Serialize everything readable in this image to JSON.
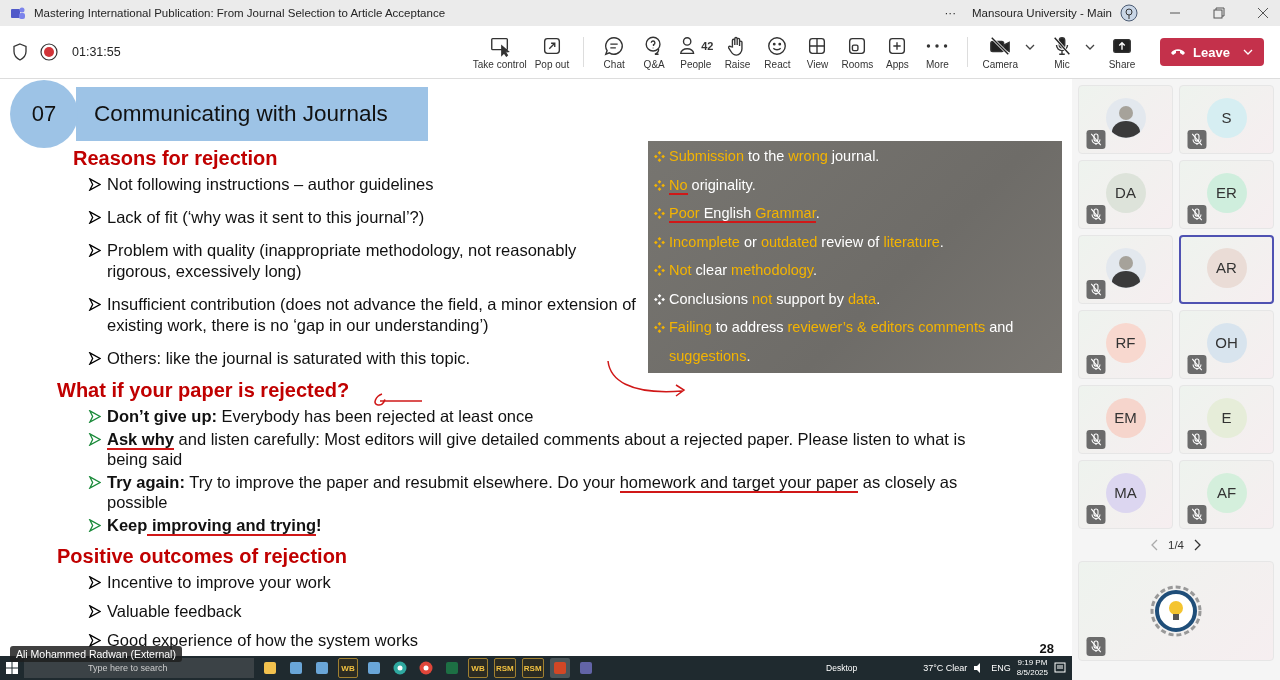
{
  "window": {
    "title": "Mastering International Publication: From Journal Selection to Article Acceptance",
    "account": "Mansoura University - Main",
    "more": "···"
  },
  "meeting": {
    "timer": "01:31:55",
    "recording": true
  },
  "toolbar": [
    {
      "kind": "take-control",
      "label": "Take control"
    },
    {
      "kind": "pop-out",
      "label": "Pop out"
    },
    {
      "kind": "divider"
    },
    {
      "kind": "chat",
      "label": "Chat"
    },
    {
      "kind": "qa",
      "label": "Q&A"
    },
    {
      "kind": "people",
      "label": "People",
      "count": "42"
    },
    {
      "kind": "raise",
      "label": "Raise"
    },
    {
      "kind": "react",
      "label": "React"
    },
    {
      "kind": "view",
      "label": "View"
    },
    {
      "kind": "rooms",
      "label": "Rooms"
    },
    {
      "kind": "apps",
      "label": "Apps"
    },
    {
      "kind": "more",
      "label": "More"
    },
    {
      "kind": "divider"
    },
    {
      "kind": "camera",
      "label": "Camera",
      "dropdown": true
    },
    {
      "kind": "mic",
      "label": "Mic",
      "dropdown": true
    },
    {
      "kind": "share",
      "label": "Share"
    }
  ],
  "leave_button": {
    "label": "Leave"
  },
  "slide": {
    "number": "07",
    "title": "Communicating with Journals",
    "page": "28",
    "sections": [
      {
        "title": "Reasons for rejection",
        "color": "#000000",
        "bullets": [
          [
            {
              "text": "Not following instructions – author guidelines",
              "ink": false
            }
          ],
          [
            {
              "text": "Lack of fit (‘why was it sent to this journal’?)",
              "ink": false
            }
          ],
          [
            {
              "text": "Problem with quality (inappropriate methodology, not reasonably rigorous, excessively long)",
              "ink": false
            }
          ],
          [
            {
              "text": "Insufficient contribution (does not advance the field, a minor extension of existing work, there is no ‘gap in our understanding’)",
              "ink": false
            }
          ],
          [
            {
              "text": "Others: like the journal is saturated with this topic.",
              "ink": false
            }
          ]
        ]
      },
      {
        "title": "What if your paper is rejected?",
        "color": "#1a8a3a",
        "bullets": [
          [
            {
              "text": "**Don’t give up:** Everybody has been rejected at least once",
              "ink": false
            }
          ],
          [
            {
              "text": "**Ask why**",
              "ink": true
            },
            {
              "text": " and listen carefully: Most editors will give detailed comments about a rejected paper. Please listen to what is being said",
              "ink": false
            }
          ],
          [
            {
              "text": "**Try again:** Try to improve the paper and resubmit elsewhere. Do your ",
              "ink": false
            },
            {
              "text": "homework and target your paper",
              "ink": true
            },
            {
              "text": " as closely as possible",
              "ink": false
            }
          ],
          [
            {
              "text": "**Keep**",
              "ink": false
            },
            {
              "text": " **improving and trying**",
              "ink": true
            },
            {
              "text": "**!**",
              "ink": false
            }
          ]
        ]
      },
      {
        "title": "Positive outcomes of rejection",
        "color": "#000000",
        "bullets": [
          [
            {
              "text": "Incentive to improve your work",
              "ink": false
            }
          ],
          [
            {
              "text": "Valuable feedback",
              "ink": false
            }
          ],
          [
            {
              "text": "Good experience of how the system works",
              "ink": false
            }
          ]
        ]
      }
    ],
    "callout": [
      [
        {
          "text": "Submission",
          "highlight": true,
          "ink": false
        },
        {
          "text": " to the ",
          "highlight": false,
          "ink": false
        },
        {
          "text": "wrong",
          "highlight": true,
          "ink": false
        },
        {
          "text": " journal.",
          "highlight": false,
          "ink": false
        }
      ],
      [
        {
          "text": "No",
          "highlight": true,
          "ink": true
        },
        {
          "text": " originality.",
          "highlight": false,
          "ink": false
        }
      ],
      [
        {
          "text": "Poor ",
          "highlight": true,
          "ink": true
        },
        {
          "text": "English",
          "highlight": false,
          "ink": true
        },
        {
          "text": " Grammar",
          "highlight": true,
          "ink": true
        },
        {
          "text": ".",
          "highlight": false,
          "ink": false
        }
      ],
      [
        {
          "text": "Incomplete",
          "highlight": true,
          "ink": false
        },
        {
          "text": " or ",
          "highlight": false,
          "ink": false
        },
        {
          "text": "outdated",
          "highlight": true,
          "ink": false
        },
        {
          "text": " review of ",
          "highlight": false,
          "ink": false
        },
        {
          "text": "literature",
          "highlight": true,
          "ink": false
        },
        {
          "text": ".",
          "highlight": false,
          "ink": false
        }
      ],
      [
        {
          "text": "Not",
          "highlight": true,
          "ink": false
        },
        {
          "text": " clear ",
          "highlight": false,
          "ink": false
        },
        {
          "text": "methodology",
          "highlight": true,
          "ink": false
        },
        {
          "text": ".",
          "highlight": false,
          "ink": false
        }
      ],
      [
        {
          "text": "Conclusions ",
          "highlight": false,
          "ink": false
        },
        {
          "text": "not",
          "highlight": true,
          "ink": false
        },
        {
          "text": " support by ",
          "highlight": false,
          "ink": false
        },
        {
          "text": "data",
          "highlight": true,
          "ink": false
        },
        {
          "text": ".",
          "highlight": false,
          "ink": false
        }
      ],
      [
        {
          "text": "Failing",
          "highlight": true,
          "ink": false
        },
        {
          "text": " to address ",
          "highlight": false,
          "ink": false
        },
        {
          "text": "reviewer’s & editors comments",
          "highlight": true,
          "ink": false
        },
        {
          "text": " and ",
          "highlight": false,
          "ink": false
        },
        {
          "text": "suggestions",
          "highlight": true,
          "ink": false
        },
        {
          "text": ".",
          "highlight": false,
          "ink": false
        }
      ]
    ]
  },
  "presenter_label": "Ali Mohammed Radwan (External)",
  "taskbar": {
    "search_placeholder": "Type here to search",
    "apps": [
      {
        "kind": "folder",
        "selected": false
      },
      {
        "kind": "app",
        "selected": false
      },
      {
        "kind": "app",
        "selected": false
      },
      {
        "kind": "badge",
        "label": "WB",
        "selected": false
      },
      {
        "kind": "app",
        "selected": false
      },
      {
        "kind": "edge",
        "selected": false
      },
      {
        "kind": "chrome",
        "selected": false
      },
      {
        "kind": "excel",
        "selected": false
      },
      {
        "kind": "badge",
        "label": "WB",
        "selected": false
      },
      {
        "kind": "badge",
        "label": "RSM",
        "selected": false
      },
      {
        "kind": "badge",
        "label": "RSM",
        "selected": false
      },
      {
        "kind": "powerpoint",
        "selected": true
      },
      {
        "kind": "teams",
        "selected": false
      }
    ],
    "desktop": "Desktop",
    "weather": "37°C  Clear",
    "language": "ENG",
    "time": "9:19 PM",
    "date": "8/5/2025"
  },
  "participants": [
    {
      "kind": "photo",
      "muted": true,
      "selected": false
    },
    {
      "kind": "initials",
      "initials": "S",
      "color": "#d6eef2",
      "muted": true,
      "selected": false
    },
    {
      "kind": "initials",
      "initials": "DA",
      "color": "#dde3da",
      "muted": true,
      "selected": false
    },
    {
      "kind": "initials",
      "initials": "ER",
      "color": "#cfeedd",
      "muted": true,
      "selected": false
    },
    {
      "kind": "photo",
      "muted": true,
      "selected": false
    },
    {
      "kind": "initials",
      "initials": "AR",
      "color": "#eadcd6",
      "muted": false,
      "selected": true
    },
    {
      "kind": "initials",
      "initials": "RF",
      "color": "#f8d8cf",
      "muted": true,
      "selected": false
    },
    {
      "kind": "initials",
      "initials": "OH",
      "color": "#d8e4ee",
      "muted": true,
      "selected": false
    },
    {
      "kind": "initials",
      "initials": "EM",
      "color": "#f6d5cc",
      "muted": true,
      "selected": false
    },
    {
      "kind": "initials",
      "initials": "E",
      "color": "#e6edd9",
      "muted": true,
      "selected": false
    },
    {
      "kind": "initials",
      "initials": "MA",
      "color": "#dcd6f0",
      "muted": true,
      "selected": false
    },
    {
      "kind": "initials",
      "initials": "AF",
      "color": "#d4efdc",
      "muted": true,
      "selected": false
    }
  ],
  "pager": "1/4",
  "featured": {
    "kind": "logo",
    "muted": true
  }
}
